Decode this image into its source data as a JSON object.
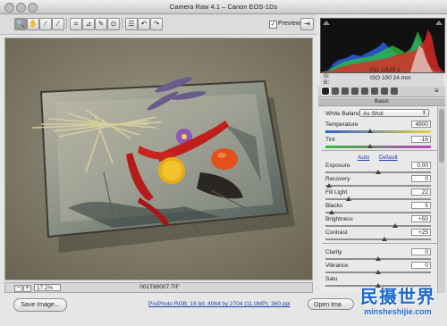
{
  "window": {
    "title": "Camera Raw 4.1  –  Canon EOS-1Ds"
  },
  "toolbar": {
    "tools": [
      "zoom-icon",
      "hand-icon",
      "white-balance-icon",
      "color-sampler-icon",
      "crop-icon",
      "straighten-icon",
      "retouch-icon",
      "red-eye-icon",
      "preferences-icon",
      "rotate-left-icon",
      "rotate-right-icon"
    ],
    "preview_label": "Preview",
    "preview_checked": true
  },
  "histogram": {
    "rgb_labels": [
      "R:",
      "G:",
      "B:"
    ]
  },
  "exif": {
    "aperture_shutter": "f/11   1/125 s",
    "iso_lens": "ISO 100   24 mm"
  },
  "panel": {
    "title": "Basic",
    "white_balance_label": "White Balance:",
    "white_balance_value": "As Shot",
    "auto_label": "Auto",
    "default_label": "Default",
    "sliders": [
      {
        "label": "Temperature",
        "value": "4900",
        "pos": 0.42
      },
      {
        "label": "Tint",
        "value": "-16",
        "pos": 0.42
      },
      {
        "label": "Exposure",
        "value": "0.00",
        "pos": 0.5
      },
      {
        "label": "Recovery",
        "value": "0",
        "pos": 0.03
      },
      {
        "label": "Fill Light",
        "value": "22",
        "pos": 0.22
      },
      {
        "label": "Blacks",
        "value": "5",
        "pos": 0.06
      },
      {
        "label": "Brightness",
        "value": "+50",
        "pos": 0.66
      },
      {
        "label": "Contrast",
        "value": "+25",
        "pos": 0.56
      },
      {
        "label": "Clarity",
        "value": "0",
        "pos": 0.5
      },
      {
        "label": "Vibrance",
        "value": "0",
        "pos": 0.5
      },
      {
        "label": "Satu",
        "value": "",
        "pos": 0.5
      }
    ]
  },
  "status": {
    "zoom_value": "17.2%",
    "filename": "001T80007.TIF"
  },
  "bottom": {
    "save_label": "Save Image...",
    "workflow_link": "ProPhoto RGB; 16 bit; 4064 by 2704 (11.0MP); 360 ppi",
    "open_label": "Open Ima"
  },
  "watermark": {
    "text_cn": "民摄世界",
    "text_url": "minsheshijie.com"
  }
}
